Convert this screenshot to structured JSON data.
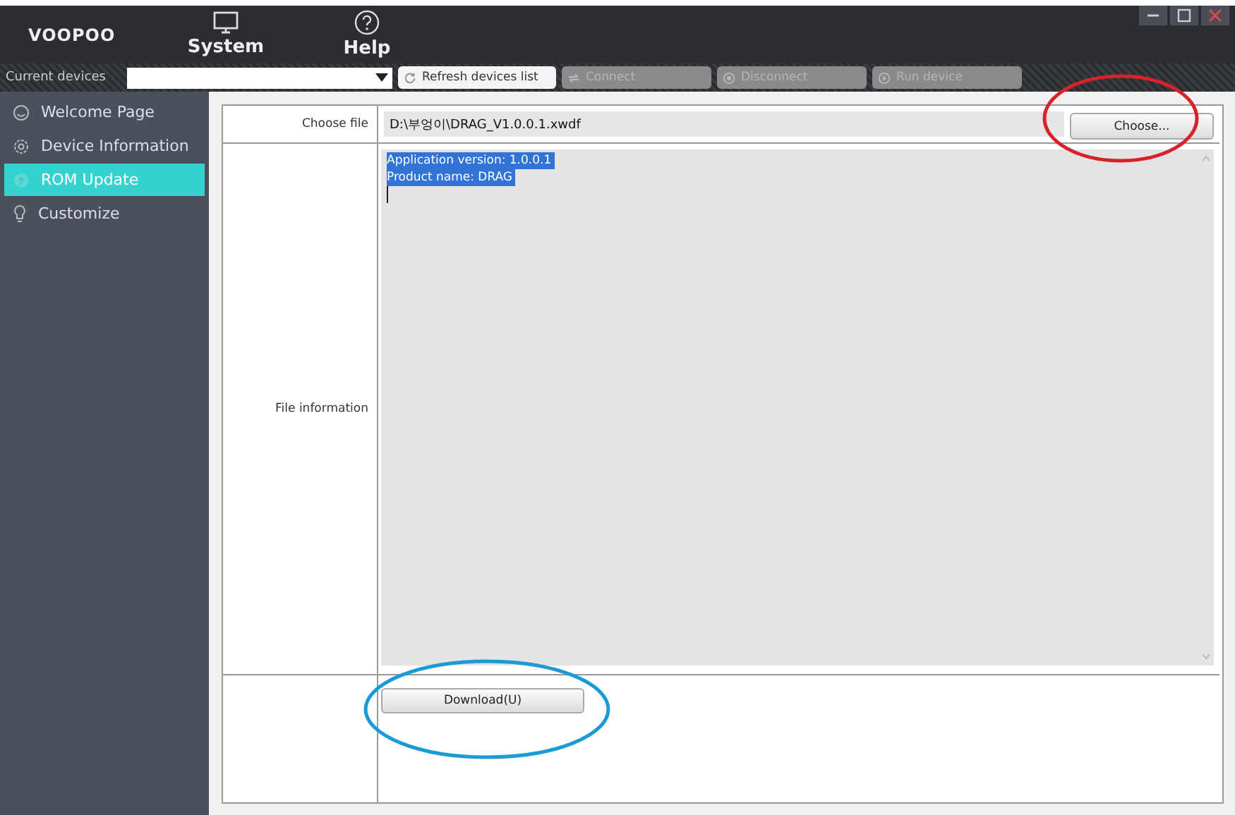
{
  "app": {
    "logo": "VOOPOO"
  },
  "menu": [
    {
      "label": "System"
    },
    {
      "label": "Help"
    }
  ],
  "toolbar": {
    "devices_label": "Current devices",
    "buttons": [
      {
        "label": "Refresh devices list",
        "disabled": false
      },
      {
        "label": "Connect",
        "disabled": true
      },
      {
        "label": "Disconnect",
        "disabled": true
      },
      {
        "label": "Run device",
        "disabled": true
      }
    ]
  },
  "sidebar": {
    "items": [
      {
        "label": "Welcome Page",
        "selected": false
      },
      {
        "label": "Device Information",
        "selected": false
      },
      {
        "label": "ROM Update",
        "selected": true
      },
      {
        "label": "Customize",
        "selected": false
      }
    ]
  },
  "form": {
    "file_label": "Choose file",
    "file_path": "D:\\부엉이\\DRAG_V1.0.0.1.xwdf",
    "choose_button": "Choose...",
    "info_label": "File information",
    "info_lines": [
      "Application version: 1.0.0.1",
      "Product name: DRAG"
    ],
    "download_button": "Download(U)"
  }
}
